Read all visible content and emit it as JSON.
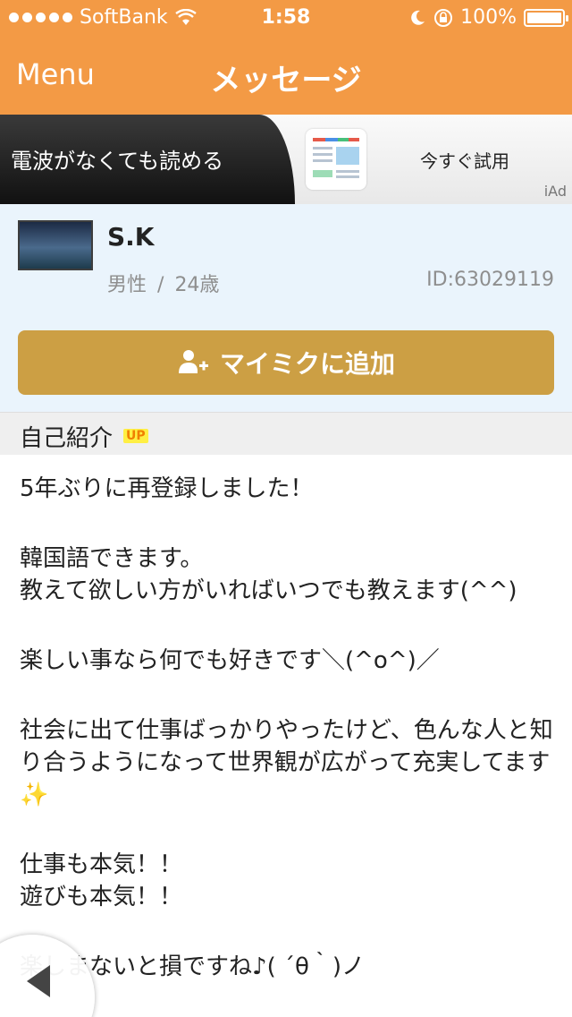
{
  "status_bar": {
    "carrier": "SoftBank",
    "time": "1:58",
    "battery": "100%"
  },
  "nav": {
    "menu_label": "Menu",
    "title": "メッセージ"
  },
  "ad": {
    "headline": "電波がなくても読める",
    "cta": "今すぐ試用",
    "tag": "iAd"
  },
  "profile": {
    "name": "S.K",
    "gender": "男性",
    "separator": "/",
    "age": "24歳",
    "id": "ID:63029119",
    "add_button_label": "マイミクに追加"
  },
  "intro": {
    "heading": "自己紹介",
    "badge": "UP",
    "paragraphs": [
      "5年ぶりに再登録しました！",
      "韓国語できます。\n教えて欲しい方がいればいつでも教えます(^^)",
      "楽しい事なら何でも好きです＼(^o^)／",
      "社会に出て仕事ばっかりやったけど、色んな人と知り合うようになって世界観が広がって充実してます",
      "仕事も本気！！\n遊びも本気！！",
      "楽しまないと損ですね♪( ´θ｀)ノ"
    ],
    "sparkle": "✨"
  }
}
